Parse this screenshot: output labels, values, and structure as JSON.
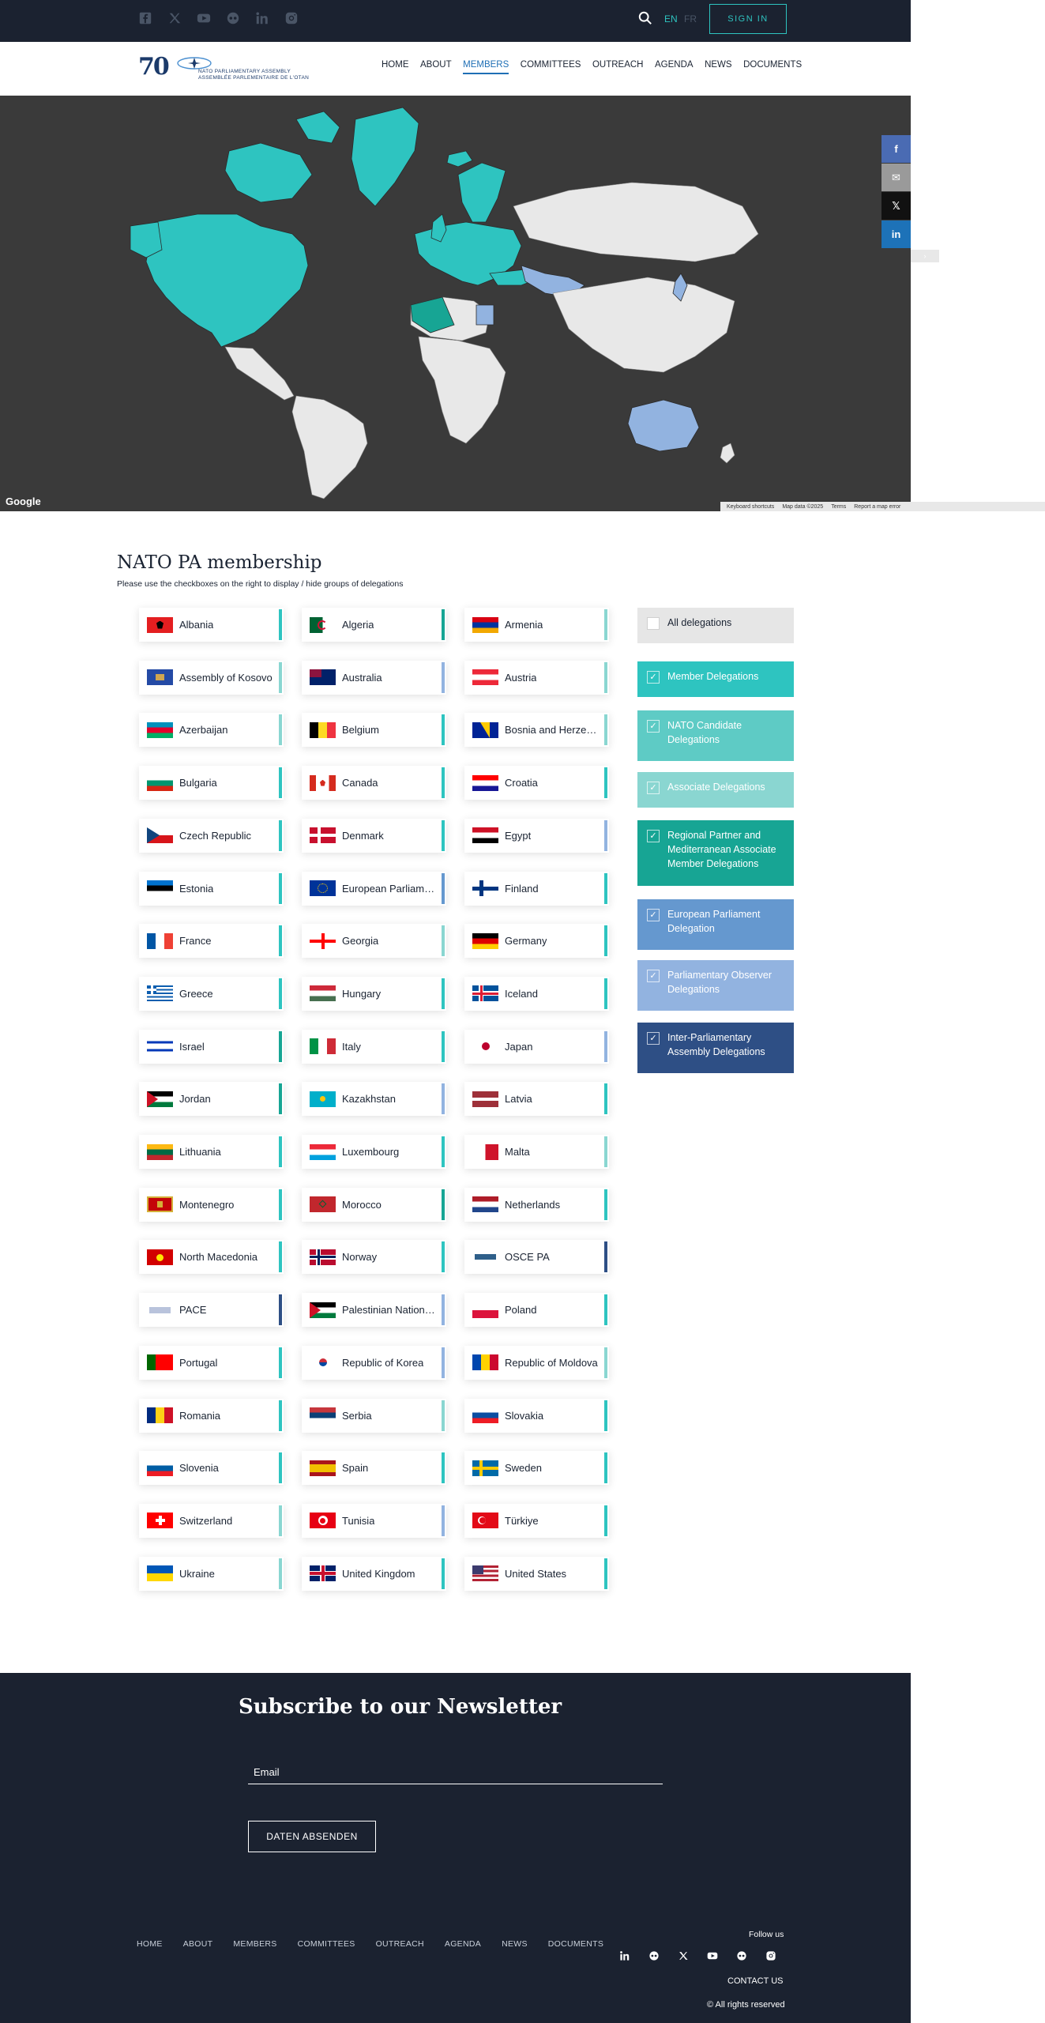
{
  "topbar": {
    "social": [
      "facebook-icon",
      "x-icon",
      "youtube-icon",
      "flickr-icon",
      "linkedin-icon",
      "instagram-icon"
    ],
    "lang_en": "EN",
    "lang_fr": "FR",
    "signin": "SIGN IN"
  },
  "logo": {
    "anniv": "70",
    "line1": "NATO PARLIAMENTARY ASSEMBLY",
    "line2": "ASSEMBLÉE PARLEMENTAIRE DE L'OTAN"
  },
  "nav": [
    "HOME",
    "ABOUT",
    "MEMBERS",
    "COMMITTEES",
    "OUTREACH",
    "AGENDA",
    "NEWS",
    "DOCUMENTS"
  ],
  "nav_active": "MEMBERS",
  "map": {
    "google": "Google",
    "footer": [
      "Keyboard shortcuts",
      "Map data ©2025",
      "Terms",
      "Report a map error"
    ]
  },
  "share": [
    "f",
    "✉",
    "𝕏",
    "in"
  ],
  "membership": {
    "title": "NATO PA membership",
    "subtitle": "Please use the checkboxes on the right to display / hide groups of delegations"
  },
  "colors": {
    "member": "#2ec4c0",
    "candidate": "#5ecbc5",
    "associate": "#8ad6d1",
    "regional": "#17a594",
    "ep": "#6598cf",
    "observer": "#92b3e0",
    "ipa": "#2e4f85",
    "all": "#e6e6e6"
  },
  "countries": [
    {
      "name": "Albania",
      "group": "member"
    },
    {
      "name": "Algeria",
      "group": "regional"
    },
    {
      "name": "Armenia",
      "group": "associate"
    },
    {
      "name": "Assembly of Kosovo",
      "group": "associate"
    },
    {
      "name": "Australia",
      "group": "observer"
    },
    {
      "name": "Austria",
      "group": "associate"
    },
    {
      "name": "Azerbaijan",
      "group": "associate"
    },
    {
      "name": "Belgium",
      "group": "member"
    },
    {
      "name": "Bosnia and Herzegovina",
      "group": "associate"
    },
    {
      "name": "Bulgaria",
      "group": "member"
    },
    {
      "name": "Canada",
      "group": "member"
    },
    {
      "name": "Croatia",
      "group": "member"
    },
    {
      "name": "Czech Republic",
      "group": "member"
    },
    {
      "name": "Denmark",
      "group": "member"
    },
    {
      "name": "Egypt",
      "group": "observer"
    },
    {
      "name": "Estonia",
      "group": "member"
    },
    {
      "name": "European Parliament",
      "group": "ep"
    },
    {
      "name": "Finland",
      "group": "member"
    },
    {
      "name": "France",
      "group": "member"
    },
    {
      "name": "Georgia",
      "group": "associate"
    },
    {
      "name": "Germany",
      "group": "member"
    },
    {
      "name": "Greece",
      "group": "member"
    },
    {
      "name": "Hungary",
      "group": "member"
    },
    {
      "name": "Iceland",
      "group": "member"
    },
    {
      "name": "Israel",
      "group": "regional"
    },
    {
      "name": "Italy",
      "group": "member"
    },
    {
      "name": "Japan",
      "group": "observer"
    },
    {
      "name": "Jordan",
      "group": "regional"
    },
    {
      "name": "Kazakhstan",
      "group": "observer"
    },
    {
      "name": "Latvia",
      "group": "member"
    },
    {
      "name": "Lithuania",
      "group": "member"
    },
    {
      "name": "Luxembourg",
      "group": "member"
    },
    {
      "name": "Malta",
      "group": "associate"
    },
    {
      "name": "Montenegro",
      "group": "member"
    },
    {
      "name": "Morocco",
      "group": "regional"
    },
    {
      "name": "Netherlands",
      "group": "member"
    },
    {
      "name": "North Macedonia",
      "group": "member"
    },
    {
      "name": "Norway",
      "group": "member"
    },
    {
      "name": "OSCE PA",
      "group": "ipa"
    },
    {
      "name": "PACE",
      "group": "ipa"
    },
    {
      "name": "Palestinian National Council",
      "group": "observer"
    },
    {
      "name": "Poland",
      "group": "member"
    },
    {
      "name": "Portugal",
      "group": "member"
    },
    {
      "name": "Republic of Korea",
      "group": "observer"
    },
    {
      "name": "Republic of Moldova",
      "group": "associate"
    },
    {
      "name": "Romania",
      "group": "member"
    },
    {
      "name": "Serbia",
      "group": "associate"
    },
    {
      "name": "Slovakia",
      "group": "member"
    },
    {
      "name": "Slovenia",
      "group": "member"
    },
    {
      "name": "Spain",
      "group": "member"
    },
    {
      "name": "Sweden",
      "group": "member"
    },
    {
      "name": "Switzerland",
      "group": "associate"
    },
    {
      "name": "Tunisia",
      "group": "observer"
    },
    {
      "name": "Türkiye",
      "group": "member"
    },
    {
      "name": "Ukraine",
      "group": "associate"
    },
    {
      "name": "United Kingdom",
      "group": "member"
    },
    {
      "name": "United States",
      "group": "member"
    }
  ],
  "filters": [
    {
      "key": "all",
      "label": "All delegations",
      "checked": false
    },
    {
      "key": "member",
      "label": "Member Delegations",
      "checked": true
    },
    {
      "key": "candidate",
      "label": "NATO Candidate Delegations",
      "checked": true
    },
    {
      "key": "associate",
      "label": "Associate Delegations",
      "checked": true
    },
    {
      "key": "regional",
      "label": "Regional Partner and Mediterranean Associate Member Delegations",
      "checked": true
    },
    {
      "key": "ep",
      "label": "European Parliament Delegation",
      "checked": true
    },
    {
      "key": "observer",
      "label": "Parliamentary Observer Delegations",
      "checked": true
    },
    {
      "key": "ipa",
      "label": "Inter-Parliamentary Assembly Delegations",
      "checked": true
    }
  ],
  "newsletter": {
    "title": "Subscribe to our Newsletter",
    "email_placeholder": "Email",
    "submit": "DATEN ABSENDEN"
  },
  "footer": {
    "nav": [
      "HOME",
      "ABOUT",
      "MEMBERS",
      "COMMITTEES",
      "OUTREACH",
      "AGENDA",
      "NEWS",
      "DOCUMENTS"
    ],
    "follow": "Follow us",
    "social": [
      "linkedin-icon",
      "flickr-icon",
      "x-icon",
      "youtube-icon",
      "flickr-dots-icon",
      "instagram-icon"
    ],
    "contact": "CONTACT US",
    "rights": "© All rights reserved"
  }
}
